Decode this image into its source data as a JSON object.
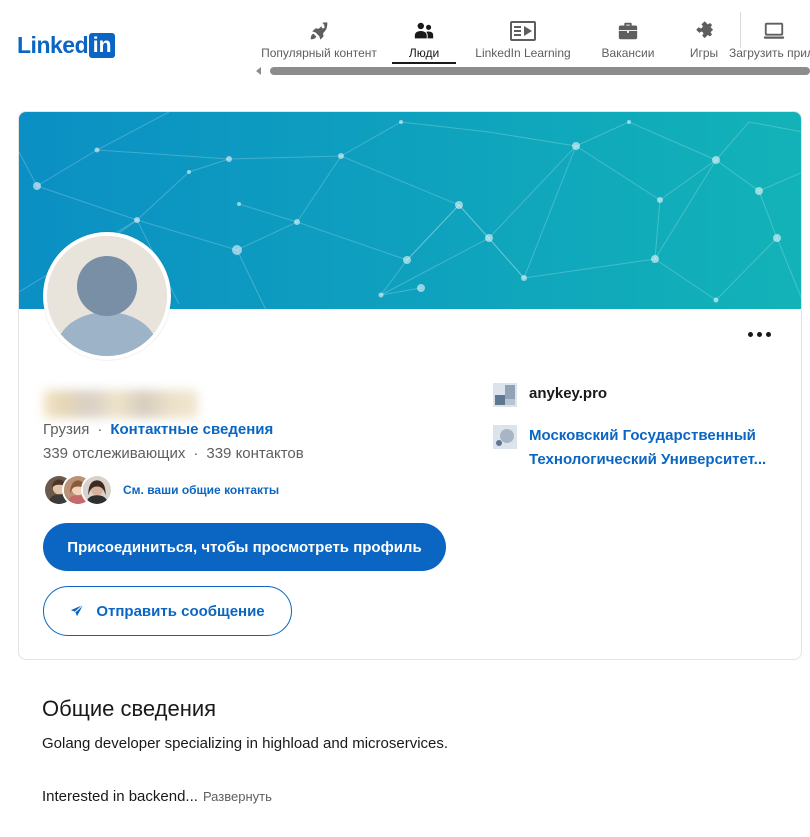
{
  "header": {
    "logo_text": "Linked",
    "logo_in": "in",
    "nav": [
      {
        "label": "Популярный контент",
        "icon": "rocket-icon"
      },
      {
        "label": "Люди",
        "icon": "people-icon",
        "active": true
      },
      {
        "label": "LinkedIn Learning",
        "icon": "video-icon"
      },
      {
        "label": "Вакансии",
        "icon": "briefcase-icon"
      },
      {
        "label": "Игры",
        "icon": "puzzle-icon"
      },
      {
        "label": "Загрузить прил",
        "icon": "laptop-icon"
      }
    ]
  },
  "profile": {
    "location": "Грузия",
    "separator": "·",
    "contact_info": "Контактные сведения",
    "followers": "339 отслеживающих",
    "connections": "339 контактов",
    "mutual_link": "См. ваши общие контакты",
    "join_button": "Присоединиться, чтобы просмотреть профиль",
    "message_button": "Отправить сообщение",
    "company": "anykey.pro",
    "education_line1": "Московский Государственный",
    "education_line2": "Технологический Университет..."
  },
  "about": {
    "title": "Общие сведения",
    "text": "Golang developer specializing in highload and microservices.",
    "more_text": "Interested in backend...",
    "expand_label": "Развернуть"
  },
  "colors": {
    "brand": "#0a66c2",
    "banner_start": "#0b8fc4",
    "banner_end": "#12b3b8"
  }
}
